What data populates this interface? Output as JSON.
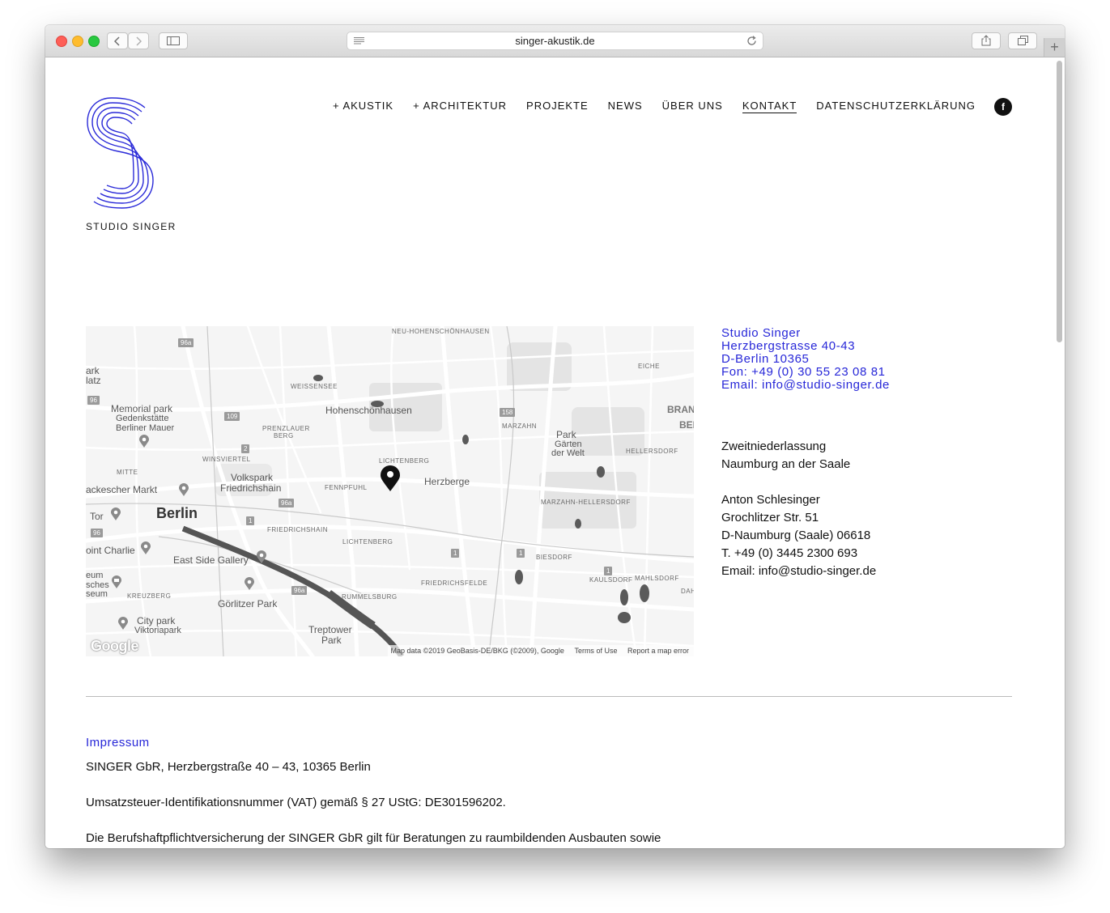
{
  "browser": {
    "url": "singer-akustik.de"
  },
  "brand": {
    "name": "STUDIO SINGER",
    "accent_color": "#2727d8"
  },
  "nav": {
    "items": [
      {
        "label": "+ AKUSTIK"
      },
      {
        "label": "+ ARCHITEKTUR"
      },
      {
        "label": "PROJEKTE"
      },
      {
        "label": "NEWS"
      },
      {
        "label": "ÜBER UNS"
      },
      {
        "label": "KONTAKT",
        "active": true
      },
      {
        "label": "DATENSCHUTZERKLÄRUNG"
      }
    ],
    "facebook_icon": "f"
  },
  "map": {
    "labels": {
      "neu_hohenschoenhausen": "NEU-HOHENSCHÖNHAUSEN",
      "weissensee": "WEISSENSEE",
      "hohenschoenhausen": "Hohenschönhausen",
      "eiche": "EICHE",
      "brand": "BRAND",
      "ber": "BER",
      "ark": "ark",
      "latz": "latz",
      "memorial1": "Memorial park",
      "memorial2": "Gedenkstätte",
      "memorial3": "Berliner Mauer",
      "prenzlauer1": "PRENZLAUER",
      "prenzlauer2": "BERG",
      "marzahn": "MARZAHN",
      "park1": "Park",
      "park2": "Gärten",
      "park3": "der Welt",
      "hellersdorf": "HELLERSDORF",
      "winsviertel": "WINSVIERTEL",
      "lichtenberg_top": "LICHTENBERG",
      "mitte": "MITTE",
      "volkspark1": "Volkspark",
      "volkspark2": "Friedrichshain",
      "fennpfuhl": "FENNPFUHL",
      "herzberge": "Herzberge",
      "hackescher": "ackescher Markt",
      "marzahn_hellersdorf": "MARZAHN-HELLERSDORF",
      "tor": "Tor",
      "berlin": "Berlin",
      "friedrichshain": "FRIEDRICHSHAIN",
      "lichtenberg": "LICHTENBERG",
      "charlie": "oint Charlie",
      "biesdorf": "BIESDORF",
      "eastside": "East Side Gallery",
      "eum": "eum",
      "sches": "sches",
      "seum": "seum",
      "friedrichsfelde": "FRIEDRICHSFELDE",
      "kaulsdorf": "KAULSDORF",
      "mahlsdorf": "MAHLSDORF",
      "dah": "DAH",
      "kreuzberg": "KREUZBERG",
      "rummelsburg": "RUMMELSBURG",
      "goerlitzer": "Görlitzer Park",
      "citypark1": "City park",
      "citypark2": "Viktoriapark",
      "treptower1": "Treptower",
      "treptower2": "Park"
    },
    "shields": {
      "s96a_top": "96a",
      "s96": "96",
      "s109": "109",
      "s2": "2",
      "s158": "158",
      "s96a_mid": "96a",
      "s1a": "1",
      "s96b": "96",
      "s1b": "1",
      "s1c": "1",
      "s1d": "1",
      "s96a_low": "96a"
    },
    "google_logo": "Google",
    "attribution": "Map data ©2019 GeoBasis-DE/BKG (©2009), Google",
    "terms": "Terms of Use",
    "report": "Report a map error"
  },
  "contact": {
    "name": "Studio Singer",
    "street": "Herzbergstrasse 40-43",
    "city": "D-Berlin 10365",
    "phone": "Fon: +49 (0) 30 55 23 08 81",
    "email": "Email: info@studio-singer.de"
  },
  "branch": {
    "title": "Zweitniederlassung",
    "location": "Naumburg an der Saale",
    "person": "Anton Schlesinger",
    "street": "Grochlitzer Str. 51",
    "city": "D-Naumburg (Saale) 06618",
    "phone": "T. +49 (0) 3445 2300 693",
    "email": "Email: info@studio-singer.de"
  },
  "impressum": {
    "title": "Impressum",
    "line1": "SINGER GbR, Herzbergstraße 40 – 43, 10365 Berlin",
    "line2": "Umsatzsteuer-Identifikationsnummer (VAT) gemäß § 27 UStG: DE301596202.",
    "line3": "Die Berufshaftpflichtversicherung der SINGER GbR gilt für Beratungen zu raumbildenden Ausbauten sowie"
  }
}
